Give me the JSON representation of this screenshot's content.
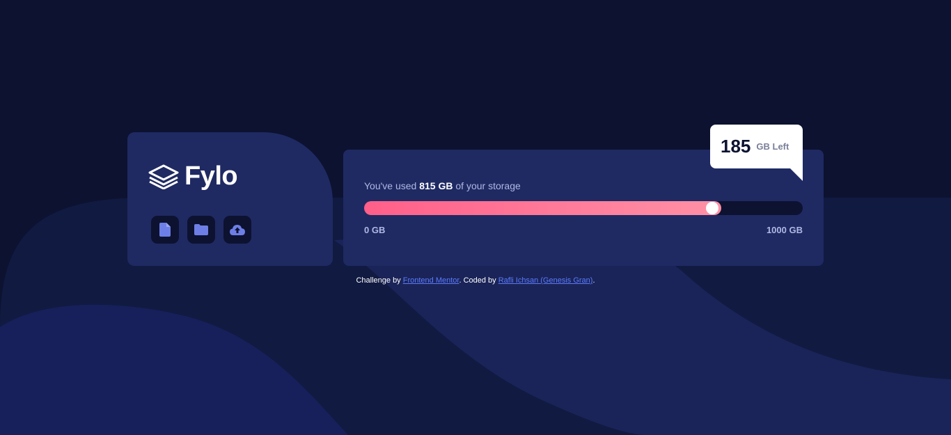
{
  "brand": {
    "name": "Fylo",
    "icon": "stacked-layers-icon"
  },
  "toolbar": {
    "buttons": [
      {
        "name": "document",
        "icon": "document-icon"
      },
      {
        "name": "folder",
        "icon": "folder-icon"
      },
      {
        "name": "upload",
        "icon": "cloud-upload-icon"
      }
    ]
  },
  "storage": {
    "usage_prefix": "You've used ",
    "used_amount": "815 GB",
    "usage_suffix": " of your storage",
    "used_fraction": 0.815,
    "scale_min": "0 GB",
    "scale_max": "1000 GB"
  },
  "remaining": {
    "number": "185",
    "unit": "GB Left"
  },
  "attribution": {
    "prefix": "Challenge by ",
    "link1": "Frontend Mentor",
    "middle": ". Coded by ",
    "link2": "Rafli Ichsan (Genesis Gran)",
    "suffix": "."
  },
  "colors": {
    "background": "#0c1230",
    "card": "#1f2a63",
    "bar_start": "#ff5f8a",
    "bar_end": "#ff91a6",
    "icon_accent": "#6d7fe6",
    "link": "#5b7bff"
  }
}
